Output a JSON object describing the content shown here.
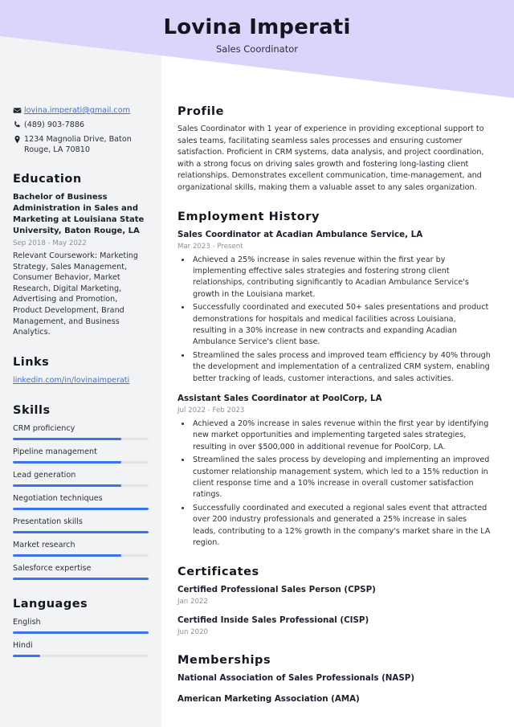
{
  "theme": {
    "banner_color": "#dcd4fb",
    "sidebar_color": "#f2f3f4",
    "accent_color": "#3b72f0",
    "link_color": "#3b6fe0",
    "muted_text_color": "#8d9099"
  },
  "header": {
    "name": "Lovina Imperati",
    "job_title": "Sales Coordinator"
  },
  "sidebar": {
    "contact": [
      {
        "icon": "envelope-icon",
        "text": "lovina.imperati@gmail.com",
        "is_link": true
      },
      {
        "icon": "phone-icon",
        "text": "(489) 903-7886",
        "is_link": false
      },
      {
        "icon": "location-pin-icon",
        "text": "1234 Magnolia Drive, Baton Rouge, LA 70810",
        "is_link": false
      }
    ],
    "education": {
      "heading": "Education",
      "degree": "Bachelor of Business Administration in Sales and Marketing at Louisiana State University, Baton Rouge, LA",
      "dates": "Sep 2018 - May 2022",
      "description": "Relevant Coursework: Marketing Strategy, Sales Management, Consumer Behavior, Market Research, Digital Marketing, Advertising and Promotion, Product Development, Brand Management, and Business Analytics."
    },
    "links": {
      "heading": "Links",
      "items": [
        {
          "label": "linkedin.com/in/lovinaimperati"
        }
      ]
    },
    "skills": {
      "heading": "Skills",
      "items": [
        {
          "label": "CRM proficiency",
          "level": 80
        },
        {
          "label": "Pipeline management",
          "level": 80
        },
        {
          "label": "Lead generation",
          "level": 80
        },
        {
          "label": "Negotiation techniques",
          "level": 100
        },
        {
          "label": "Presentation skills",
          "level": 100
        },
        {
          "label": "Market research",
          "level": 80
        },
        {
          "label": "Salesforce expertise",
          "level": 100
        }
      ]
    },
    "languages": {
      "heading": "Languages",
      "items": [
        {
          "label": "English",
          "level": 100
        },
        {
          "label": "Hindi",
          "level": 20
        }
      ]
    }
  },
  "main": {
    "profile": {
      "heading": "Profile",
      "text": "Sales Coordinator with 1 year of experience in providing exceptional support to sales teams, facilitating seamless sales processes and ensuring customer satisfaction. Proficient in CRM systems, data analysis, and project coordination, with a strong focus on driving sales growth and fostering long-lasting client relationships. Demonstrates excellent communication, time-management, and organizational skills, making them a valuable asset to any sales organization."
    },
    "employment": {
      "heading": "Employment History",
      "jobs": [
        {
          "title": "Sales Coordinator at Acadian Ambulance Service, LA",
          "dates": "Mar 2023 - Present",
          "bullets": [
            "Achieved a 25% increase in sales revenue within the first year by implementing effective sales strategies and fostering strong client relationships, contributing significantly to Acadian Ambulance Service's growth in the Louisiana market.",
            "Successfully coordinated and executed 50+ sales presentations and product demonstrations for hospitals and medical facilities across Louisiana, resulting in a 30% increase in new contracts and expanding Acadian Ambulance Service's client base.",
            "Streamlined the sales process and improved team efficiency by 40% through the development and implementation of a centralized CRM system, enabling better tracking of leads, customer interactions, and sales activities."
          ]
        },
        {
          "title": "Assistant Sales Coordinator at PoolCorp, LA",
          "dates": "Jul 2022 - Feb 2023",
          "bullets": [
            "Achieved a 20% increase in sales revenue within the first year by identifying new market opportunities and implementing targeted sales strategies, resulting in over $500,000 in additional revenue for PoolCorp, LA.",
            "Streamlined the sales process by developing and implementing an improved customer relationship management system, which led to a 15% reduction in client response time and a 10% increase in overall customer satisfaction ratings.",
            "Successfully coordinated and executed a regional sales event that attracted over 200 industry professionals and generated a 25% increase in sales leads, contributing to a 12% growth in the company's market share in the LA region."
          ]
        }
      ]
    },
    "certificates": {
      "heading": "Certificates",
      "items": [
        {
          "title": "Certified Professional Sales Person (CPSP)",
          "date": "Jan 2022"
        },
        {
          "title": "Certified Inside Sales Professional (CISP)",
          "date": "Jun 2020"
        }
      ]
    },
    "memberships": {
      "heading": "Memberships",
      "items": [
        {
          "title": "National Association of Sales Professionals (NASP)"
        },
        {
          "title": "American Marketing Association (AMA)"
        }
      ]
    }
  }
}
